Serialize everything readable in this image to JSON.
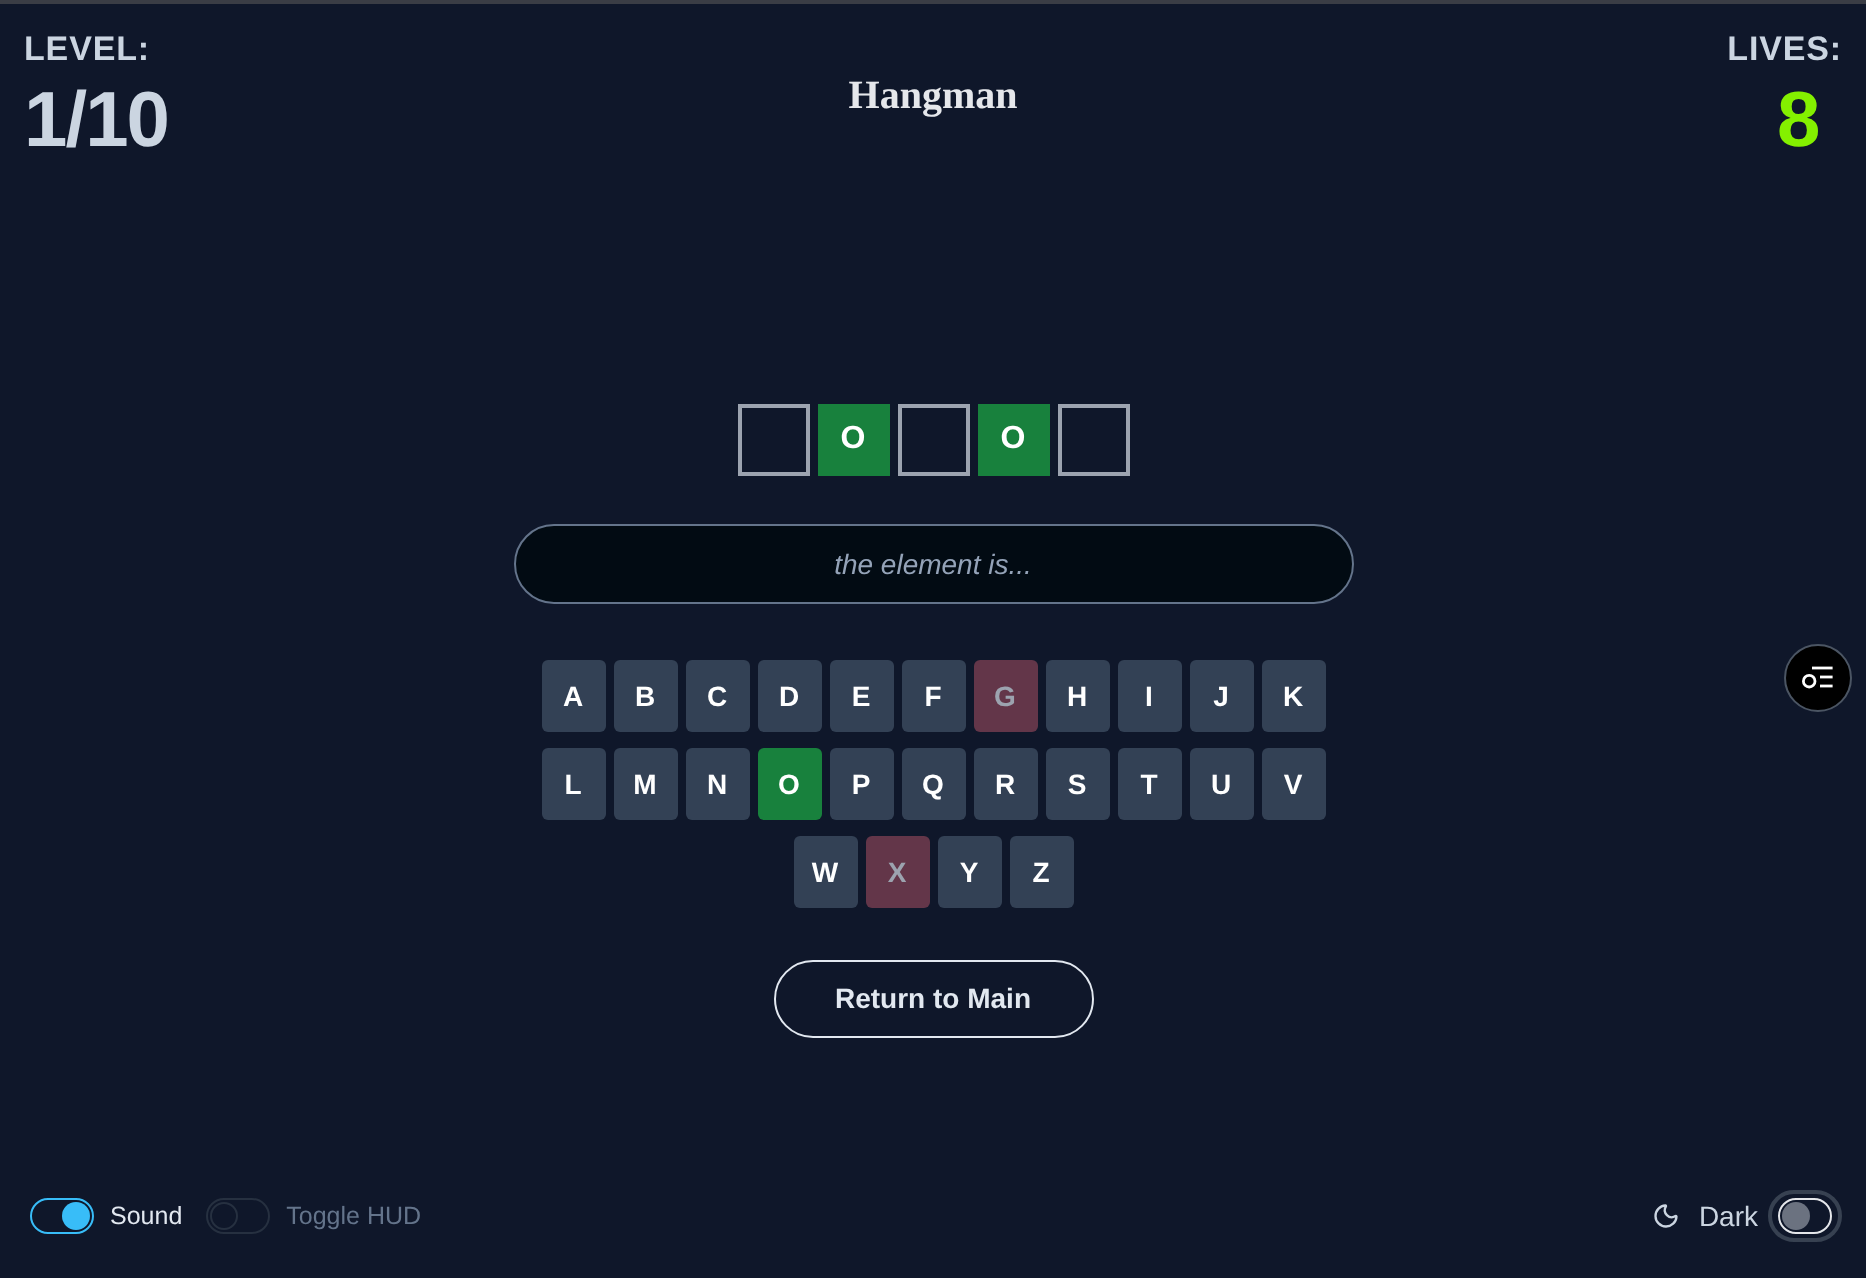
{
  "hud": {
    "level_label": "LEVEL:",
    "level_value": "1/10",
    "title": "Hangman",
    "lives_label": "LIVES:",
    "lives_value": "8"
  },
  "word": {
    "slots": [
      {
        "revealed": false
      },
      {
        "letter": "O",
        "revealed": true
      },
      {
        "revealed": false
      },
      {
        "letter": "O",
        "revealed": true
      },
      {
        "revealed": false
      }
    ]
  },
  "hint": {
    "placeholder": "the element is..."
  },
  "keyboard": {
    "rows": [
      [
        {
          "letter": "A",
          "hit": false,
          "miss": false
        },
        {
          "letter": "B",
          "hit": false,
          "miss": false
        },
        {
          "letter": "C",
          "hit": false,
          "miss": false
        },
        {
          "letter": "D",
          "hit": false,
          "miss": false
        },
        {
          "letter": "E",
          "hit": false,
          "miss": false
        },
        {
          "letter": "F",
          "hit": false,
          "miss": false
        },
        {
          "letter": "G",
          "hit": false,
          "miss": true
        },
        {
          "letter": "H",
          "hit": false,
          "miss": false
        },
        {
          "letter": "I",
          "hit": false,
          "miss": false
        },
        {
          "letter": "J",
          "hit": false,
          "miss": false
        },
        {
          "letter": "K",
          "hit": false,
          "miss": false
        }
      ],
      [
        {
          "letter": "L",
          "hit": false,
          "miss": false
        },
        {
          "letter": "M",
          "hit": false,
          "miss": false
        },
        {
          "letter": "N",
          "hit": false,
          "miss": false
        },
        {
          "letter": "O",
          "hit": true,
          "miss": false
        },
        {
          "letter": "P",
          "hit": false,
          "miss": false
        },
        {
          "letter": "Q",
          "hit": false,
          "miss": false
        },
        {
          "letter": "R",
          "hit": false,
          "miss": false
        },
        {
          "letter": "S",
          "hit": false,
          "miss": false
        },
        {
          "letter": "T",
          "hit": false,
          "miss": false
        },
        {
          "letter": "U",
          "hit": false,
          "miss": false
        },
        {
          "letter": "V",
          "hit": false,
          "miss": false
        }
      ],
      [
        {
          "letter": "W",
          "hit": false,
          "miss": false
        },
        {
          "letter": "X",
          "hit": false,
          "miss": true
        },
        {
          "letter": "Y",
          "hit": false,
          "miss": false
        },
        {
          "letter": "Z",
          "hit": false,
          "miss": false
        }
      ]
    ]
  },
  "return_button": {
    "label": "Return to Main"
  },
  "footer": {
    "toggles": [
      {
        "label": "Sound",
        "on": true
      },
      {
        "label": "Toggle HUD",
        "on": false
      }
    ],
    "theme": {
      "label": "Dark",
      "on": false
    }
  }
}
